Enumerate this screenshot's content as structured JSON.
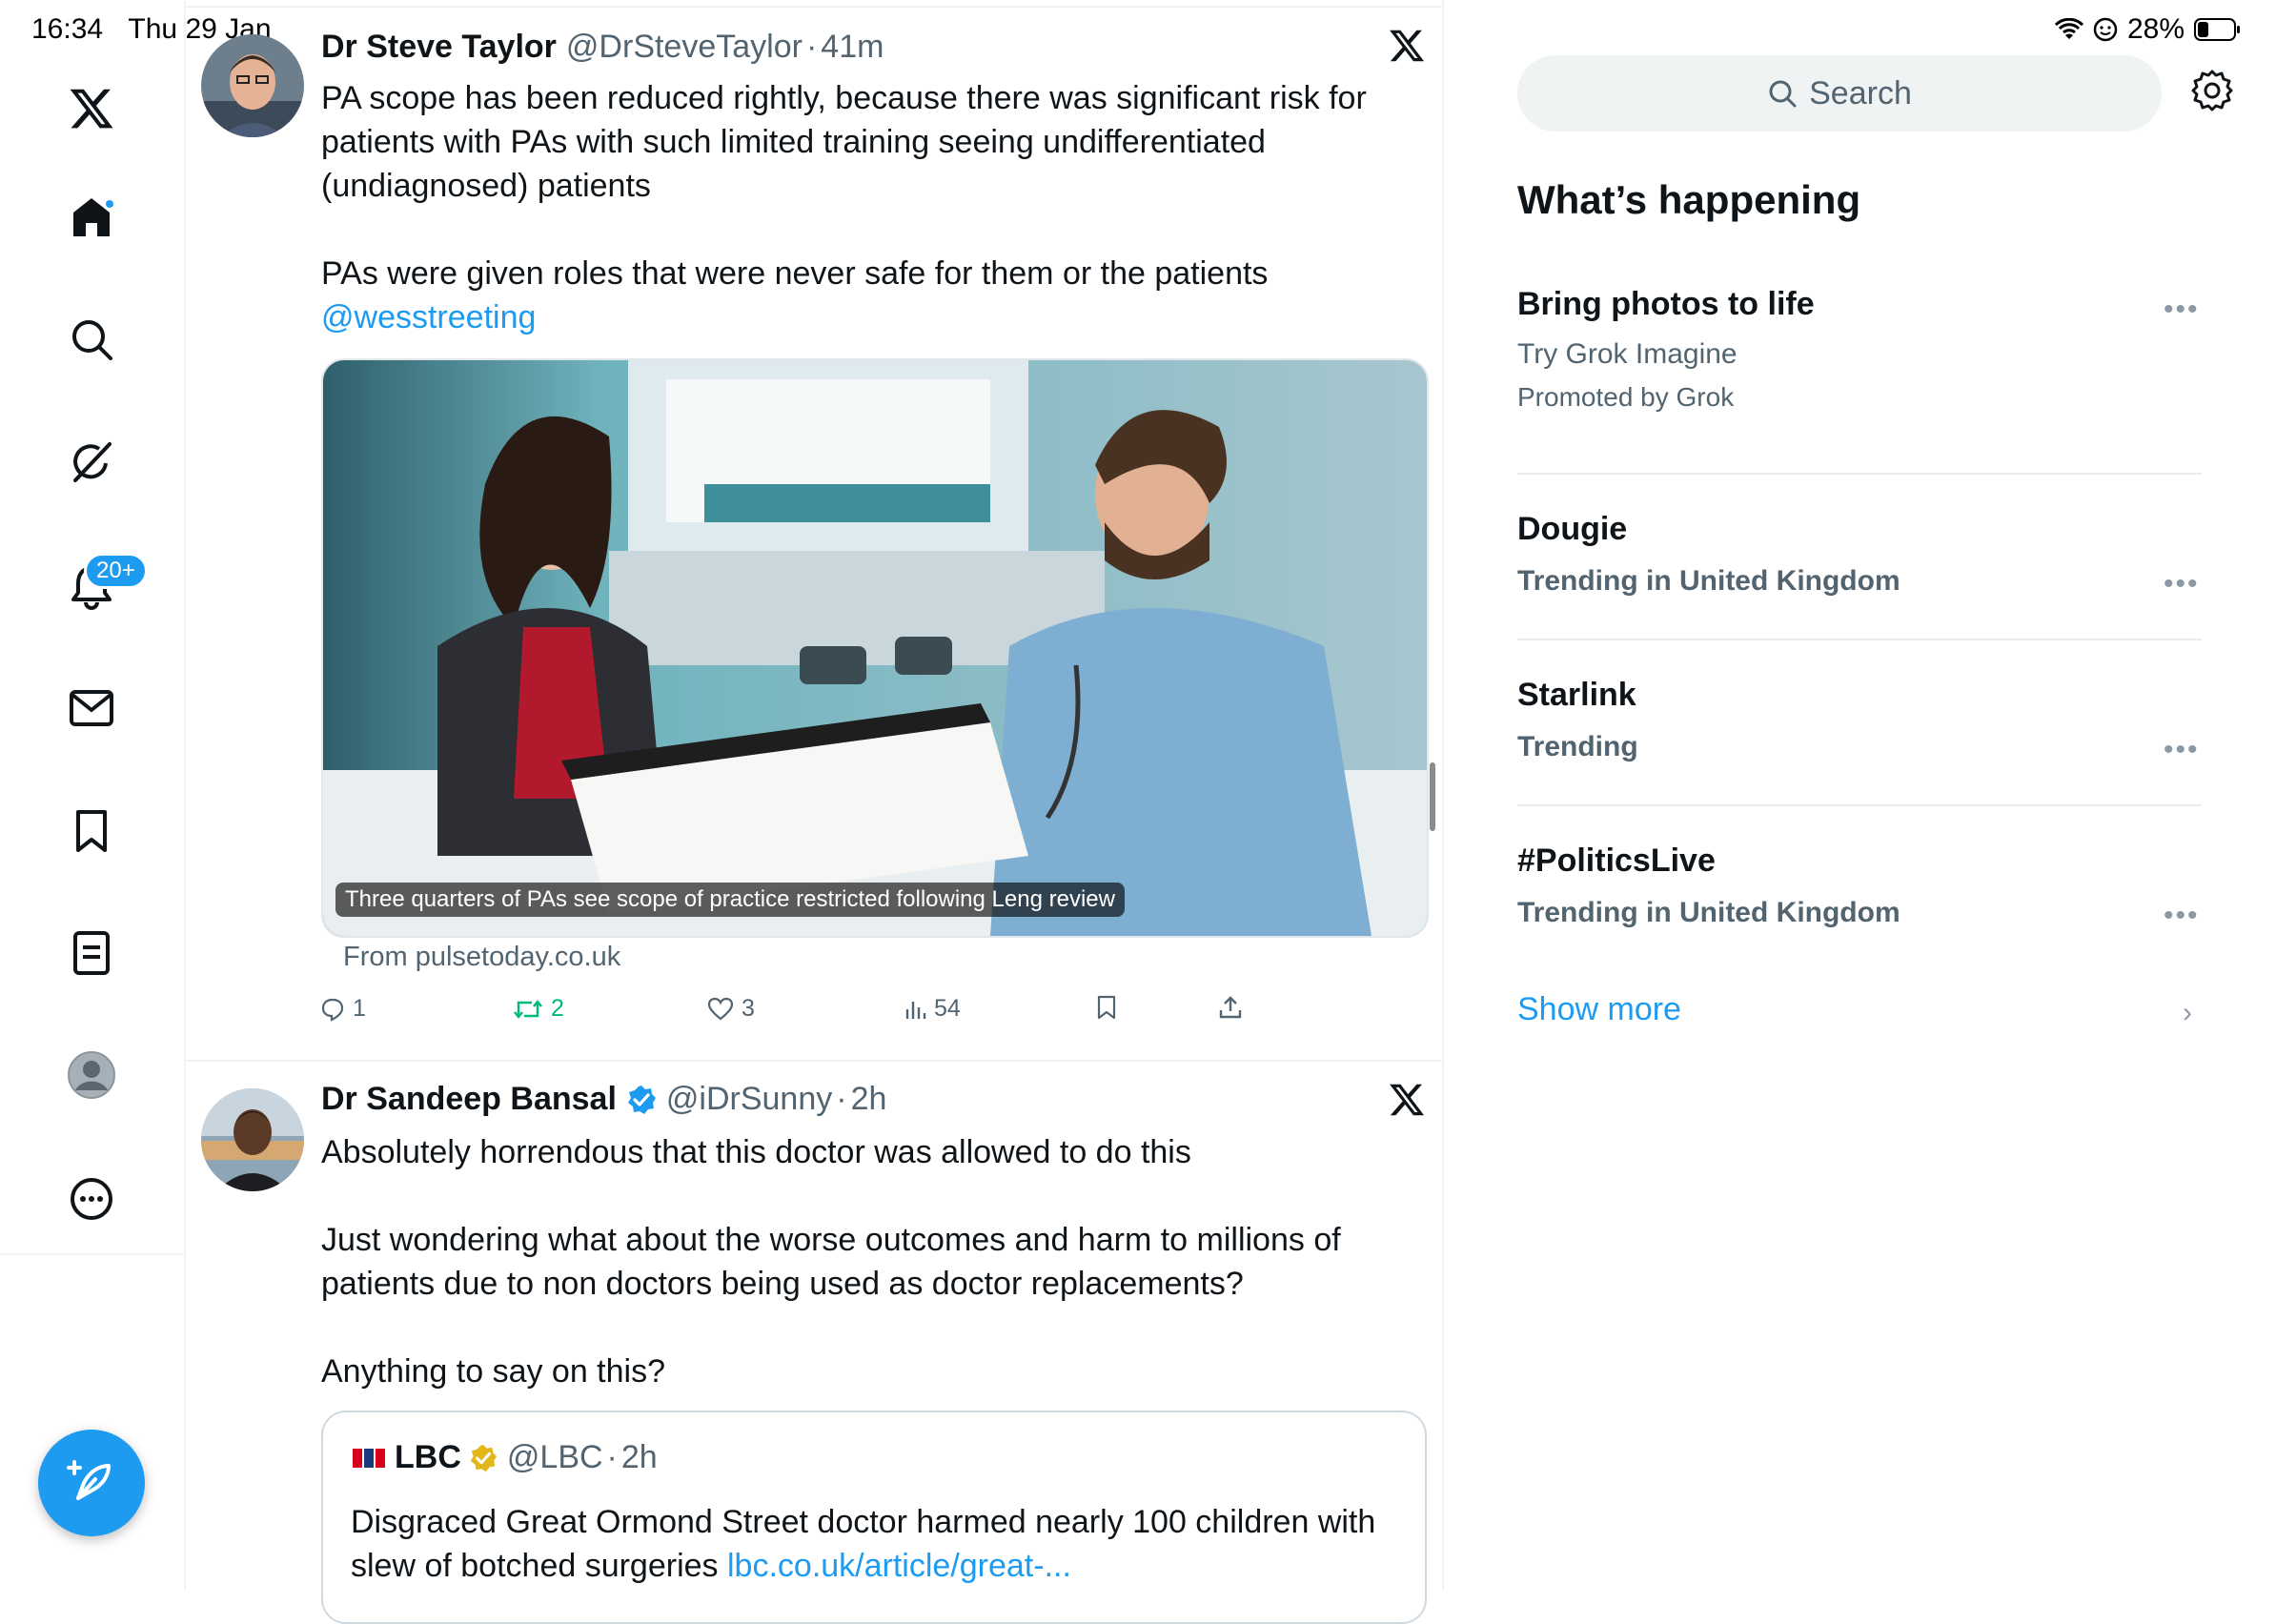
{
  "status_bar": {
    "time": "16:34",
    "date": "Thu 29 Jan",
    "battery": "28%"
  },
  "nav": {
    "items": [
      {
        "name": "home-icon"
      },
      {
        "name": "search-icon"
      },
      {
        "name": "grok-icon"
      },
      {
        "name": "notifications-icon"
      },
      {
        "name": "messages-icon"
      },
      {
        "name": "bookmarks-icon"
      },
      {
        "name": "lists-icon"
      },
      {
        "name": "profile-icon"
      },
      {
        "name": "more-icon"
      }
    ],
    "notifications_badge": "20+"
  },
  "posts": [
    {
      "name": "Dr Steve Taylor",
      "handle": "@DrSteveTaylor",
      "time": "41m",
      "text_lines": [
        "PA scope has been reduced rightly, because there was significant risk for",
        "patients with PAs with such limited training seeing undifferentiated",
        "(undiagnosed) patients",
        "",
        "PAs were given roles that were never safe for them or the patients"
      ],
      "mention": "@wesstreeting",
      "media_caption": "Three quarters of PAs see scope of practice restricted following Leng review",
      "source": "From pulsetoday.co.uk",
      "stats": {
        "replies": "1",
        "reposts": "2",
        "likes": "3",
        "views": "54"
      }
    },
    {
      "name": "Dr Sandeep Bansal",
      "handle": "@iDrSunny",
      "time": "2h",
      "text_lines": [
        "Absolutely horrendous that this doctor was allowed to do this",
        "",
        "Just wondering what about the worse outcomes and harm to millions of",
        "patients due to non doctors being used as doctor replacements?",
        "",
        "Anything to say on this?"
      ],
      "quote": {
        "name": "LBC",
        "handle": "@LBC",
        "time": "2h",
        "text_line1": "Disgraced Great Ormond Street doctor harmed nearly 100 children with",
        "text_line2": "slew of botched surgeries",
        "link": "lbc.co.uk/article/great-..."
      }
    }
  ],
  "sidebar": {
    "search_placeholder": "Search",
    "section_title": "What’s happening",
    "trends": [
      {
        "title": "Bring photos to life",
        "subtitle": "Try Grok Imagine",
        "meta": "Promoted by Grok"
      },
      {
        "title": "Dougie",
        "meta": "Trending in United Kingdom"
      },
      {
        "title": "Starlink",
        "meta": "Trending"
      },
      {
        "title": "#PoliticsLive",
        "meta": "Trending in United Kingdom"
      }
    ],
    "show_more": "Show more"
  },
  "colors": {
    "accent": "#1d9bf0",
    "text": "#0f1419",
    "muted": "#536471",
    "repost_green": "#00ba7c",
    "verified_gold": "#e2b719"
  }
}
